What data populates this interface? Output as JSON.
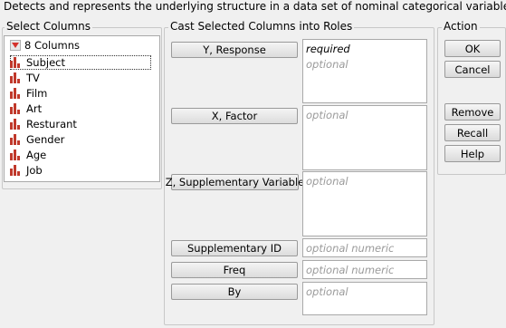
{
  "description": "Detects and represents the underlying structure in a data set of nominal categorical variables.",
  "select_columns": {
    "title": "Select Columns",
    "count_label": "8 Columns",
    "items": [
      "Subject",
      "TV",
      "Film",
      "Art",
      "Resturant",
      "Gender",
      "Age",
      "Job"
    ],
    "selected": "Subject"
  },
  "roles": {
    "title": "Cast Selected Columns into Roles",
    "items": [
      {
        "label": "Y, Response",
        "hint_required": "required",
        "hint": "optional"
      },
      {
        "label": "X, Factor",
        "hint": "optional"
      },
      {
        "label": "Z, Supplementary Variable",
        "hint": "optional"
      },
      {
        "label": "Supplementary ID",
        "hint": "optional numeric"
      },
      {
        "label": "Freq",
        "hint": "optional numeric"
      },
      {
        "label": "By",
        "hint": "optional"
      }
    ]
  },
  "action": {
    "title": "Action",
    "ok": "OK",
    "cancel": "Cancel",
    "remove": "Remove",
    "recall": "Recall",
    "help": "Help"
  },
  "colors": {
    "icon_red": "#c0392b",
    "triangle_red": "#d4322c",
    "hint_gray": "#9a9a9a"
  },
  "icons": [
    "menu-triangle-icon",
    "nominal-column-icon"
  ]
}
